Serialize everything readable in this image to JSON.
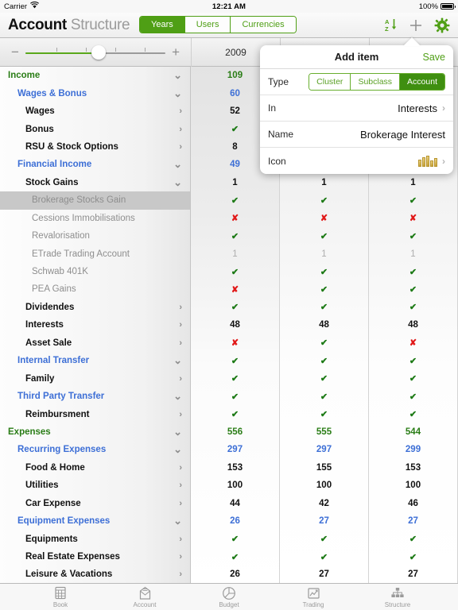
{
  "status": {
    "carrier": "Carrier",
    "wifi_icon": "wifi-icon",
    "time": "12:21 AM",
    "battery_pct": "100%"
  },
  "nav": {
    "title": "Account",
    "subtitle": "Structure",
    "segments": [
      {
        "label": "Years",
        "selected": true
      },
      {
        "label": "Users",
        "selected": false
      },
      {
        "label": "Currencies",
        "selected": false
      }
    ],
    "icons": [
      {
        "name": "sort-az-icon"
      },
      {
        "name": "add-icon"
      },
      {
        "name": "gear-icon"
      }
    ]
  },
  "toolbar": {
    "minus": "−",
    "plus": "+",
    "zoom_value": 52
  },
  "columns": [
    {
      "year": "2009"
    },
    {
      "year": ""
    },
    {
      "year": ""
    }
  ],
  "tree": [
    {
      "label": "Income",
      "level": 0,
      "style": "t-green",
      "chev": "down",
      "selected": false
    },
    {
      "label": "Wages & Bonus",
      "level": 1,
      "style": "t-blue",
      "chev": "down",
      "selected": false
    },
    {
      "label": "Wages",
      "level": 2,
      "style": "t-black",
      "chev": "right",
      "selected": false
    },
    {
      "label": "Bonus",
      "level": 2,
      "style": "t-black",
      "chev": "right",
      "selected": false
    },
    {
      "label": "RSU & Stock Options",
      "level": 2,
      "style": "t-black",
      "chev": "right",
      "selected": false
    },
    {
      "label": "Financial Income",
      "level": 1,
      "style": "t-blue",
      "chev": "down",
      "selected": false
    },
    {
      "label": "Stock Gains",
      "level": 2,
      "style": "t-black",
      "chev": "down",
      "selected": false
    },
    {
      "label": "Brokerage Stocks Gain",
      "level": 3,
      "style": "t-gray",
      "chev": "",
      "selected": true
    },
    {
      "label": "Cessions Immobilisations",
      "level": 3,
      "style": "t-gray",
      "chev": "",
      "selected": false
    },
    {
      "label": "Revalorisation",
      "level": 3,
      "style": "t-gray",
      "chev": "",
      "selected": false
    },
    {
      "label": "ETrade Trading Account",
      "level": 3,
      "style": "t-gray",
      "chev": "",
      "selected": false
    },
    {
      "label": "Schwab 401K",
      "level": 3,
      "style": "t-gray",
      "chev": "",
      "selected": false
    },
    {
      "label": "PEA Gains",
      "level": 3,
      "style": "t-gray",
      "chev": "",
      "selected": false
    },
    {
      "label": "Dividendes",
      "level": 2,
      "style": "t-black",
      "chev": "right",
      "selected": false
    },
    {
      "label": "Interests",
      "level": 2,
      "style": "t-black",
      "chev": "right",
      "selected": false
    },
    {
      "label": "Asset Sale",
      "level": 2,
      "style": "t-black",
      "chev": "right",
      "selected": false
    },
    {
      "label": "Internal Transfer",
      "level": 1,
      "style": "t-blue",
      "chev": "down",
      "selected": false
    },
    {
      "label": "Family",
      "level": 2,
      "style": "t-black",
      "chev": "right",
      "selected": false
    },
    {
      "label": "Third Party Transfer",
      "level": 1,
      "style": "t-blue",
      "chev": "down",
      "selected": false
    },
    {
      "label": "Reimbursment",
      "level": 2,
      "style": "t-black",
      "chev": "right",
      "selected": false
    },
    {
      "label": "Expenses",
      "level": 0,
      "style": "t-green",
      "chev": "down",
      "selected": false
    },
    {
      "label": "Recurring Expenses",
      "level": 1,
      "style": "t-blue",
      "chev": "down",
      "selected": false
    },
    {
      "label": "Food & Home",
      "level": 2,
      "style": "t-black",
      "chev": "right",
      "selected": false
    },
    {
      "label": "Utilities",
      "level": 2,
      "style": "t-black",
      "chev": "right",
      "selected": false
    },
    {
      "label": "Car Expense",
      "level": 2,
      "style": "t-black",
      "chev": "right",
      "selected": false
    },
    {
      "label": "Equipment Expenses",
      "level": 1,
      "style": "t-blue",
      "chev": "down",
      "selected": false
    },
    {
      "label": "Equipments",
      "level": 2,
      "style": "t-black",
      "chev": "right",
      "selected": false
    },
    {
      "label": "Real Estate Expenses",
      "level": 2,
      "style": "t-black",
      "chev": "right",
      "selected": false
    },
    {
      "label": "Leisure & Vacations",
      "level": 2,
      "style": "t-black",
      "chev": "right",
      "selected": false
    }
  ],
  "grid": {
    "col1": [
      {
        "v": "109",
        "s": "c-green"
      },
      {
        "v": "60",
        "s": "c-blue"
      },
      {
        "v": "52",
        "s": "c-black"
      },
      {
        "v": "✔",
        "s": "c-ok"
      },
      {
        "v": "8",
        "s": "c-black"
      },
      {
        "v": "49",
        "s": "c-blue"
      },
      {
        "v": "1",
        "s": "c-black"
      },
      {
        "v": "✔",
        "s": "c-ok"
      },
      {
        "v": "✘",
        "s": "c-no"
      },
      {
        "v": "✔",
        "s": "c-ok"
      },
      {
        "v": "1",
        "s": "c-gray"
      },
      {
        "v": "✔",
        "s": "c-ok"
      },
      {
        "v": "✘",
        "s": "c-no"
      },
      {
        "v": "✔",
        "s": "c-ok"
      },
      {
        "v": "48",
        "s": "c-black"
      },
      {
        "v": "✘",
        "s": "c-no"
      },
      {
        "v": "✔",
        "s": "c-ok"
      },
      {
        "v": "✔",
        "s": "c-ok"
      },
      {
        "v": "✔",
        "s": "c-ok"
      },
      {
        "v": "✔",
        "s": "c-ok"
      },
      {
        "v": "556",
        "s": "c-green"
      },
      {
        "v": "297",
        "s": "c-blue"
      },
      {
        "v": "153",
        "s": "c-black"
      },
      {
        "v": "100",
        "s": "c-black"
      },
      {
        "v": "44",
        "s": "c-black"
      },
      {
        "v": "26",
        "s": "c-blue"
      },
      {
        "v": "✔",
        "s": "c-ok"
      },
      {
        "v": "✔",
        "s": "c-ok"
      },
      {
        "v": "26",
        "s": "c-black"
      }
    ],
    "col2": [
      {
        "v": "",
        "s": ""
      },
      {
        "v": "",
        "s": ""
      },
      {
        "v": "",
        "s": ""
      },
      {
        "v": "",
        "s": ""
      },
      {
        "v": "",
        "s": ""
      },
      {
        "v": "",
        "s": ""
      },
      {
        "v": "1",
        "s": "c-black"
      },
      {
        "v": "✔",
        "s": "c-ok"
      },
      {
        "v": "✘",
        "s": "c-no"
      },
      {
        "v": "✔",
        "s": "c-ok"
      },
      {
        "v": "1",
        "s": "c-gray"
      },
      {
        "v": "✔",
        "s": "c-ok"
      },
      {
        "v": "✔",
        "s": "c-ok"
      },
      {
        "v": "✔",
        "s": "c-ok"
      },
      {
        "v": "48",
        "s": "c-black"
      },
      {
        "v": "✔",
        "s": "c-ok"
      },
      {
        "v": "✔",
        "s": "c-ok"
      },
      {
        "v": "✔",
        "s": "c-ok"
      },
      {
        "v": "✔",
        "s": "c-ok"
      },
      {
        "v": "✔",
        "s": "c-ok"
      },
      {
        "v": "555",
        "s": "c-green"
      },
      {
        "v": "297",
        "s": "c-blue"
      },
      {
        "v": "155",
        "s": "c-black"
      },
      {
        "v": "100",
        "s": "c-black"
      },
      {
        "v": "42",
        "s": "c-black"
      },
      {
        "v": "27",
        "s": "c-blue"
      },
      {
        "v": "✔",
        "s": "c-ok"
      },
      {
        "v": "✔",
        "s": "c-ok"
      },
      {
        "v": "27",
        "s": "c-black"
      }
    ],
    "col3": [
      {
        "v": "",
        "s": ""
      },
      {
        "v": "",
        "s": ""
      },
      {
        "v": "",
        "s": ""
      },
      {
        "v": "",
        "s": ""
      },
      {
        "v": "",
        "s": ""
      },
      {
        "v": "",
        "s": ""
      },
      {
        "v": "1",
        "s": "c-black"
      },
      {
        "v": "✔",
        "s": "c-ok"
      },
      {
        "v": "✘",
        "s": "c-no"
      },
      {
        "v": "✔",
        "s": "c-ok"
      },
      {
        "v": "1",
        "s": "c-gray"
      },
      {
        "v": "✔",
        "s": "c-ok"
      },
      {
        "v": "✔",
        "s": "c-ok"
      },
      {
        "v": "✔",
        "s": "c-ok"
      },
      {
        "v": "48",
        "s": "c-black"
      },
      {
        "v": "✘",
        "s": "c-no"
      },
      {
        "v": "✔",
        "s": "c-ok"
      },
      {
        "v": "✔",
        "s": "c-ok"
      },
      {
        "v": "✔",
        "s": "c-ok"
      },
      {
        "v": "✔",
        "s": "c-ok"
      },
      {
        "v": "544",
        "s": "c-green"
      },
      {
        "v": "299",
        "s": "c-blue"
      },
      {
        "v": "153",
        "s": "c-black"
      },
      {
        "v": "100",
        "s": "c-black"
      },
      {
        "v": "46",
        "s": "c-black"
      },
      {
        "v": "27",
        "s": "c-blue"
      },
      {
        "v": "✔",
        "s": "c-ok"
      },
      {
        "v": "✔",
        "s": "c-ok"
      },
      {
        "v": "27",
        "s": "c-black"
      }
    ]
  },
  "popover": {
    "title": "Add item",
    "save_label": "Save",
    "type_label": "Type",
    "type_options": [
      {
        "label": "Cluster",
        "selected": false
      },
      {
        "label": "Subclass",
        "selected": false
      },
      {
        "label": "Account",
        "selected": true
      }
    ],
    "in_label": "In",
    "in_value": "Interests",
    "name_label": "Name",
    "name_value": "Brokerage Interest",
    "icon_label": "Icon",
    "icon_value": "coins-stack-icon"
  },
  "tabbar": [
    {
      "label": "Book",
      "icon": "book-icon",
      "active": false
    },
    {
      "label": "Account",
      "icon": "account-icon",
      "active": false
    },
    {
      "label": "Budget",
      "icon": "budget-pie-icon",
      "active": false
    },
    {
      "label": "Trading",
      "icon": "trading-icon",
      "active": false
    },
    {
      "label": "Structure",
      "icon": "structure-icon",
      "active": true
    }
  ],
  "colors": {
    "accent_green": "#4f9f15",
    "blue": "#3d6fd6",
    "dark_green": "#2a7d16",
    "red": "#e11919"
  }
}
